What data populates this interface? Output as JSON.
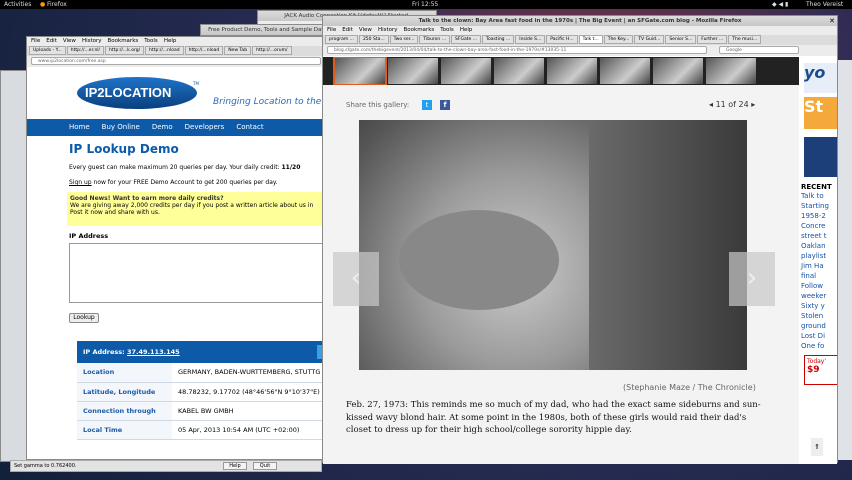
{
  "topbar": {
    "activities": "Activities",
    "app": "Firefox",
    "clock": "Fri 12:55",
    "user": "Theo Vereist"
  },
  "bg_windows": {
    "jack": "JACK Audio Connection Kit [(default)] Started.",
    "ip2free": "Free Product Demo, Tools and Sample Data"
  },
  "left": {
    "menu": [
      "File",
      "Edit",
      "View",
      "History",
      "Bookmarks",
      "Tools",
      "Help"
    ],
    "tabs": [
      "Uploads - Y...",
      "http://...er.nl/",
      "http://...k.org/",
      "http://...nload",
      "http://...nload",
      "New Tab",
      "http://...orum/"
    ],
    "url": "www.ip2location.com/free.asp",
    "logo": "IP2LOCATION",
    "tm": "TM",
    "tagline": "Bringing Location to the",
    "nav": [
      "Home",
      "Buy Online",
      "Demo",
      "Developers",
      "Contact"
    ],
    "heading": "IP Lookup Demo",
    "intro_a": "Every guest can make maximum 20 queries per day. Your daily credit: ",
    "intro_b": "11/20",
    "signup_link": "Sign up",
    "signup_rest": " now for your FREE Demo Account to get 200 queries per day.",
    "news_title": "Good News! Want to earn more daily credits?",
    "news_body": "We are giving away 2,000 credits per day if you post a written article about us in",
    "news_body2": "Post it now and share with us.",
    "ip_label": "IP Address",
    "lookup_btn": "Lookup",
    "result_label": "IP Address: ",
    "result_ip": "37.49.113.145",
    "rows": [
      {
        "k": "Location",
        "v": "GERMANY, BADEN-WURTTEMBERG, STUTTG"
      },
      {
        "k": "Latitude, Longitude",
        "v": "48.78232, 9.17702 (48°46'56\"N   9°10'37\"E)"
      },
      {
        "k": "Connection through",
        "v": "KABEL BW GMBH"
      },
      {
        "k": "Local Time",
        "v": "05 Apr, 2013 10:54 AM (UTC +02:00)"
      }
    ],
    "status": "Set gamma to 0.762400.",
    "help_btn": "Help",
    "quit_btn": "Quit"
  },
  "right": {
    "title": "Talk to the clown: Bay Area fast food in the 1970s | The Big Event | an SFGate.com blog - Mozilla Firefox",
    "menu": [
      "File",
      "Edit",
      "View",
      "History",
      "Bookmarks",
      "Tools",
      "Help"
    ],
    "tabs": [
      "program ...",
      "250 Sta...",
      "Two ser...",
      "Tiburon ...",
      "SFGate ...",
      "Toasting ...",
      "Inside S...",
      "Pacific H...",
      "Talk t...",
      "The Key...",
      "TV Guid...",
      "Senior S...",
      "Further ...",
      "The musi..."
    ],
    "url": "blog.sfgate.com/thebigevent/2013/04/04/talk-to-the-clown-bay-area-fast-food-in-the-1970s/#13035-11",
    "search_placeholder": "Google",
    "share_label": "Share this gallery:",
    "counter": "11 of 24",
    "credit": "(Stephanie Maze / The Chronicle)",
    "caption": "Feb. 27, 1973: This reminds me so much of my dad, who had the exact same sideburns and sun-kissed wavy blond hair. At some point in the 1980s, both of these girls would raid their dad's closet to dress up for their high school/college sorority hippie day.",
    "side_heading": "RECENT",
    "side_links": [
      "Talk to",
      "Starting",
      "1958-2",
      "Concre",
      "street t",
      "Oaklan",
      "playlist",
      "Jim Ha",
      "final",
      "Follow",
      "weeker",
      "Sixty y",
      "Stolen",
      "ground",
      "Lost Di",
      "One fo"
    ],
    "today": "Today'",
    "price": "$9"
  },
  "colors": {
    "ip_blue": "#0d5aa8",
    "twitter": "#1da1f2",
    "facebook": "#3b5998"
  }
}
